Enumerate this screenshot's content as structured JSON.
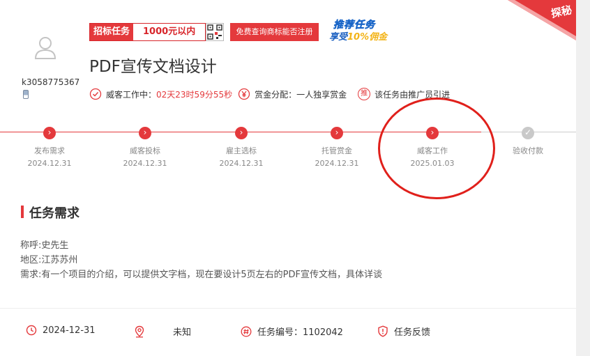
{
  "user": {
    "name": "k3058775367"
  },
  "badges": {
    "tag_label": "招标任务",
    "budget": "1000元以内",
    "free_button": "免费查询商标能否注册",
    "promo_line1": "推荐任务",
    "promo_line2_a": "享受",
    "promo_line2_b": "10%佣金",
    "corner": "探秘"
  },
  "task": {
    "title": "PDF宣传文档设计",
    "status_label": "威客工作中：",
    "countdown": "02天23时59分55秒",
    "reward_label": "赏金分配：",
    "reward_value": "一人独享赏金",
    "promoter": "该任务由推广员引进",
    "promoter_icon_text": "推"
  },
  "progress": {
    "steps": [
      {
        "name": "发布需求",
        "date": "2024.12.31"
      },
      {
        "name": "威客投标",
        "date": "2024.12.31"
      },
      {
        "name": "雇主选标",
        "date": "2024.12.31"
      },
      {
        "name": "托管赏金",
        "date": "2024.12.31"
      },
      {
        "name": "威客工作",
        "date": "2025.01.03"
      },
      {
        "name": "验收付款",
        "date": ""
      }
    ]
  },
  "requirements": {
    "heading": "任务需求",
    "contact": "称呼:史先生",
    "region": "地区:江苏苏州",
    "desc": "需求:有一个项目的介绍，可以提供文字档，现在要设计5页左右的PDF宣传文档，具体详谈"
  },
  "footer": {
    "date": "2024-12-31",
    "location": "未知",
    "task_no": "任务编号：1102042",
    "feedback": "任务反馈"
  },
  "colors": {
    "accent": "#e4393c",
    "annotation": "#e0201b"
  }
}
